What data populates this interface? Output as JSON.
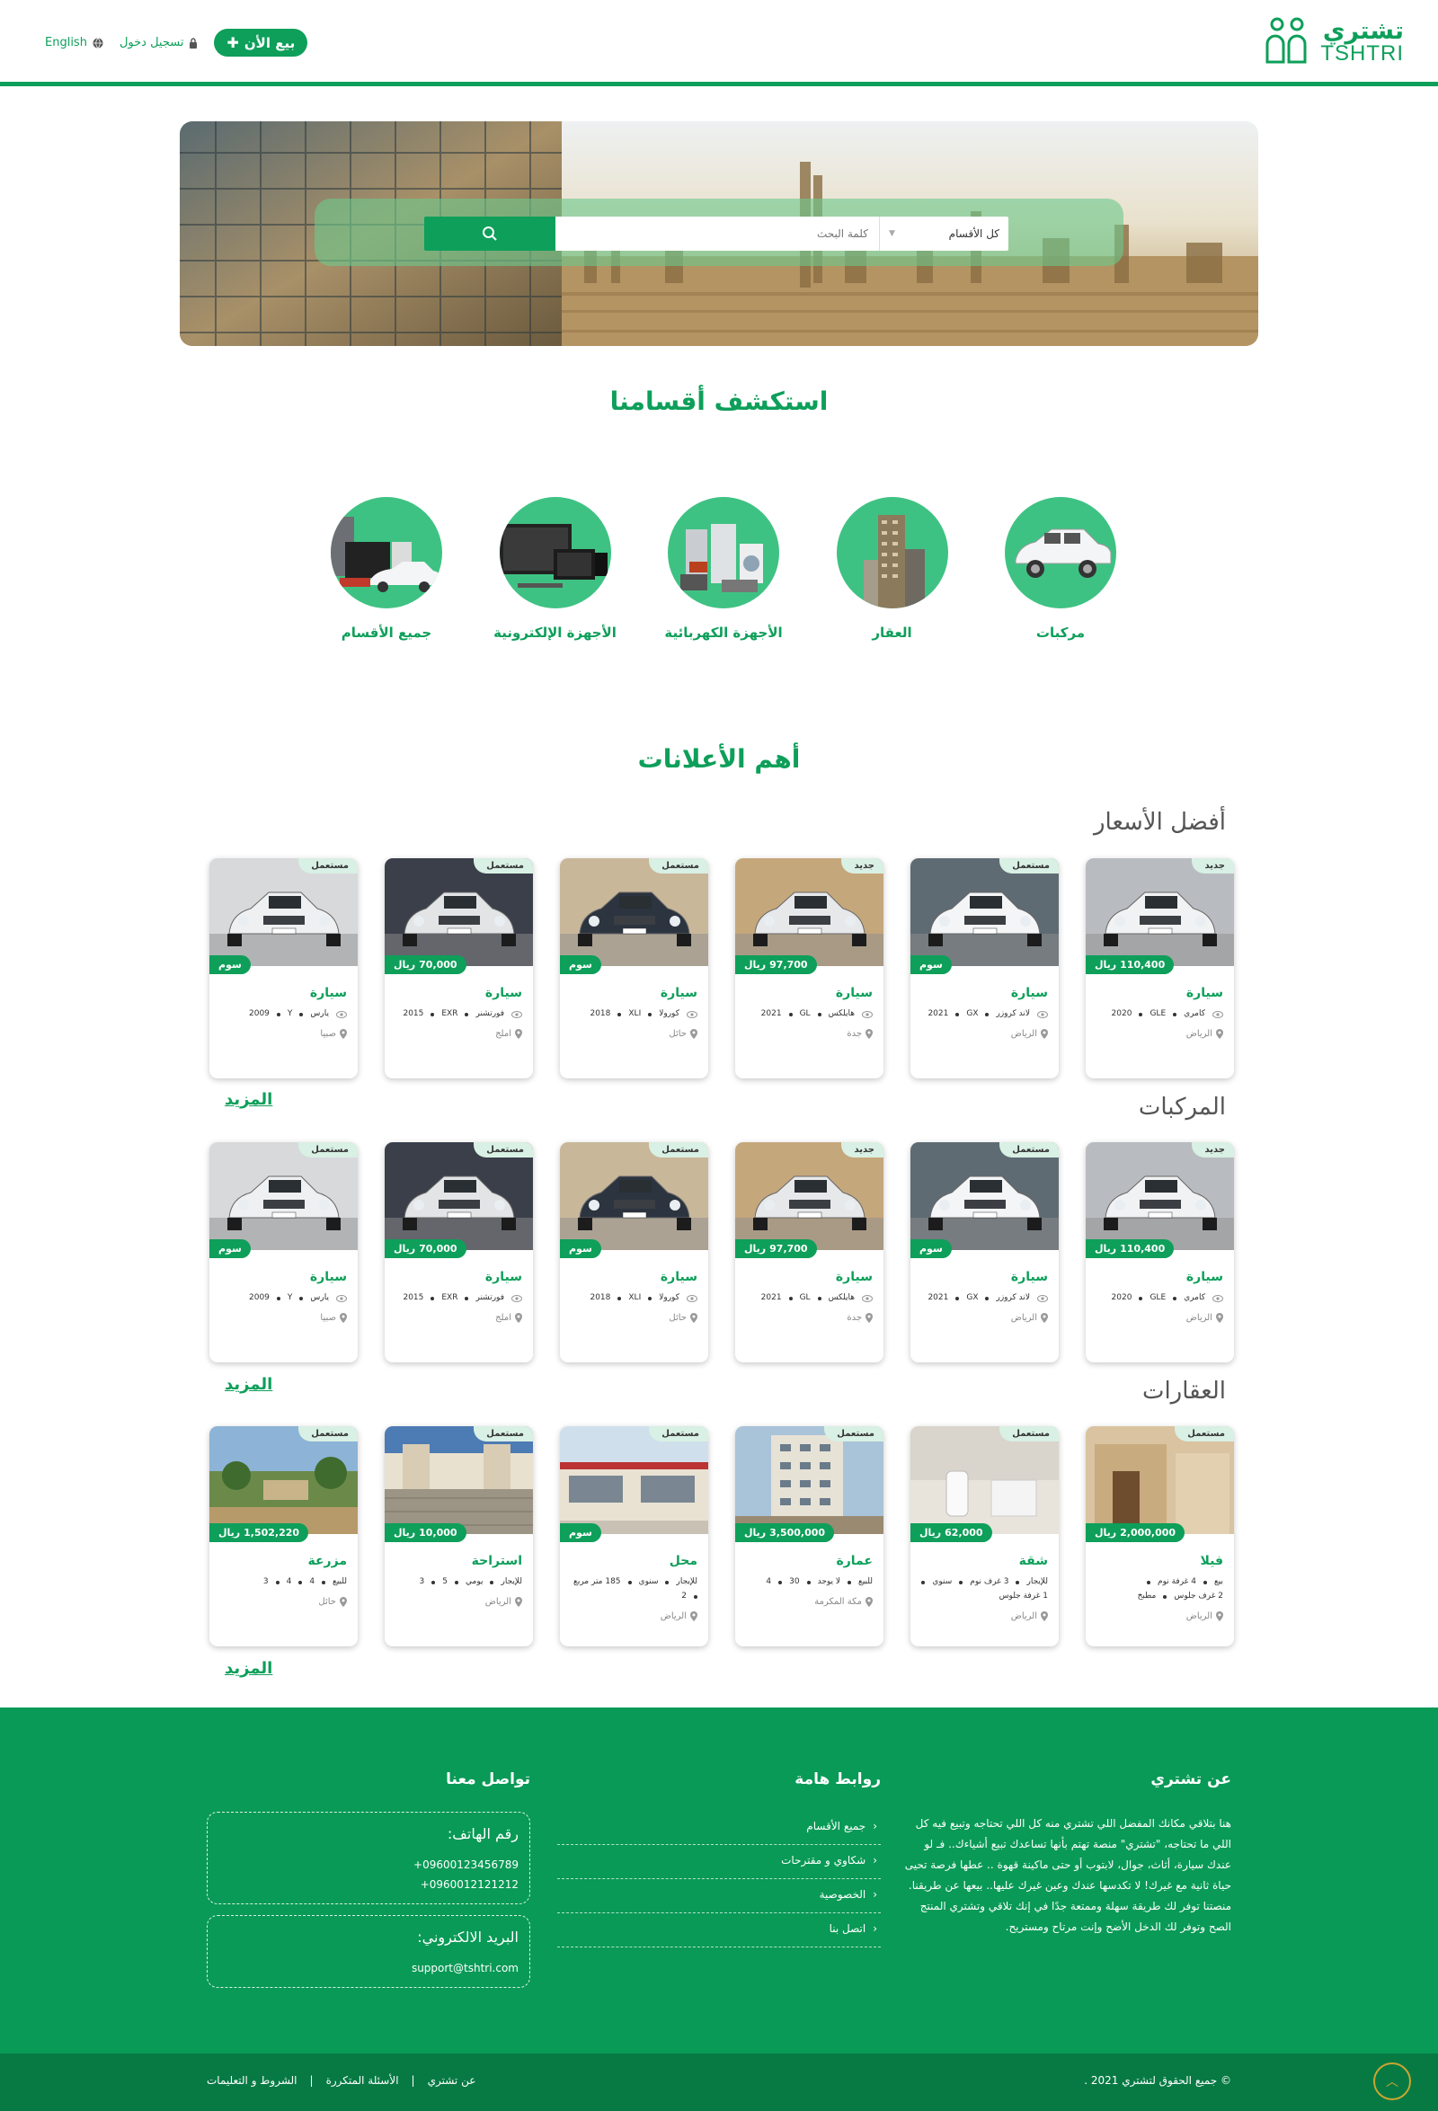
{
  "header": {
    "logo_ar": "تشتري",
    "logo_en": "TSHTRI",
    "sell_label": "بيع الأن",
    "login_label": "تسجيل دخول",
    "language_label": "English"
  },
  "search": {
    "category_selected": "كل الأقسام",
    "placeholder": "كلمة البحث"
  },
  "categories_section": {
    "title": "استكشف أقسامنا",
    "items": [
      {
        "label": "مركبات",
        "icon": "car-icon"
      },
      {
        "label": "العقار",
        "icon": "building-icon"
      },
      {
        "label": "الأجهزة الكهربائية",
        "icon": "appliances-icon"
      },
      {
        "label": "الأجهزة الإلكترونية",
        "icon": "electronics-icon"
      },
      {
        "label": "جميع الأقسام",
        "icon": "all-categories-icon"
      }
    ]
  },
  "ads_section": {
    "title": "أهم الأعلانات",
    "more_label": "المزيد",
    "rows": [
      {
        "title": "أفضل الأسعار",
        "cards": [
          {
            "badge": "جديد",
            "price": "110,400",
            "currency": "ريال",
            "title": "سيارة",
            "specs": [
              "كامري",
              "GLE",
              "2020"
            ],
            "location": "الرياض",
            "img": "white-camry"
          },
          {
            "badge": "مستعمل",
            "price": "سوم",
            "currency": "",
            "title": "سيارة",
            "specs": [
              "لاند كروزر",
              "GX",
              "2021"
            ],
            "location": "الرياض",
            "img": "landcruiser"
          },
          {
            "badge": "جديد",
            "price": "97,700",
            "currency": "ريال",
            "title": "سيارة",
            "specs": [
              "هايلكس",
              "GL",
              "2021"
            ],
            "location": "جدة",
            "img": "hilux"
          },
          {
            "badge": "مستعمل",
            "price": "سوم",
            "currency": "",
            "title": "سيارة",
            "specs": [
              "كورولا",
              "XLI",
              "2018"
            ],
            "location": "حائل",
            "img": "corolla"
          },
          {
            "badge": "مستعمل",
            "price": "70,000",
            "currency": "ريال",
            "title": "سيارة",
            "specs": [
              "فورتشنر",
              "EXR",
              "2015"
            ],
            "location": "املج",
            "img": "fortuner"
          },
          {
            "badge": "مستعمل",
            "price": "سوم",
            "currency": "",
            "title": "سيارة",
            "specs": [
              "يارس",
              "Y",
              "2009"
            ],
            "location": "صبيا",
            "img": "yaris"
          }
        ]
      },
      {
        "title": "المركبات",
        "cards": [
          {
            "badge": "جديد",
            "price": "110,400",
            "currency": "ريال",
            "title": "سيارة",
            "specs": [
              "كامري",
              "GLE",
              "2020"
            ],
            "location": "الرياض",
            "img": "white-camry"
          },
          {
            "badge": "مستعمل",
            "price": "سوم",
            "currency": "",
            "title": "سيارة",
            "specs": [
              "لاند كروزر",
              "GX",
              "2021"
            ],
            "location": "الرياض",
            "img": "landcruiser"
          },
          {
            "badge": "جديد",
            "price": "97,700",
            "currency": "ريال",
            "title": "سيارة",
            "specs": [
              "هايلكس",
              "GL",
              "2021"
            ],
            "location": "جدة",
            "img": "hilux"
          },
          {
            "badge": "مستعمل",
            "price": "سوم",
            "currency": "",
            "title": "سيارة",
            "specs": [
              "كورولا",
              "XLI",
              "2018"
            ],
            "location": "حائل",
            "img": "corolla"
          },
          {
            "badge": "مستعمل",
            "price": "70,000",
            "currency": "ريال",
            "title": "سيارة",
            "specs": [
              "فورتشنر",
              "EXR",
              "2015"
            ],
            "location": "املج",
            "img": "fortuner"
          },
          {
            "badge": "مستعمل",
            "price": "سوم",
            "currency": "",
            "title": "سيارة",
            "specs": [
              "يارس",
              "Y",
              "2009"
            ],
            "location": "صبيا",
            "img": "yaris"
          }
        ]
      },
      {
        "title": "العقارات",
        "cards": [
          {
            "badge": "مستعمل",
            "price": "2,000,000",
            "currency": "ريال",
            "title": "فيلا",
            "specs": [
              "بيع",
              "4 غرفة نوم",
              "2 غرف جلوس",
              "مطبخ"
            ],
            "location": "الرياض",
            "img": "villa"
          },
          {
            "badge": "مستعمل",
            "price": "62,000",
            "currency": "ريال",
            "title": "شقة",
            "specs": [
              "للإيجار",
              "3 غرف نوم",
              "سنوي",
              "1 غرفة جلوس"
            ],
            "location": "الرياض",
            "img": "apartment"
          },
          {
            "badge": "مستعمل",
            "price": "3,500,000",
            "currency": "ريال",
            "title": "عمارة",
            "specs": [
              "للبيع",
              "لا يوجد",
              "30",
              "4"
            ],
            "location": "مكة المكرمة",
            "img": "tower"
          },
          {
            "badge": "مستعمل",
            "price": "سوم",
            "currency": "",
            "title": "محل",
            "specs": [
              "للإيجار",
              "سنوي",
              "185 متر مربع",
              "2"
            ],
            "location": "الرياض",
            "img": "shop"
          },
          {
            "badge": "مستعمل",
            "price": "10,000",
            "currency": "ريال",
            "title": "استراحة",
            "specs": [
              "للإيجار",
              "يومي",
              "5",
              "3"
            ],
            "location": "الرياض",
            "img": "rest"
          },
          {
            "badge": "مستعمل",
            "price": "1,502,220",
            "currency": "ريال",
            "title": "مزرعة",
            "specs": [
              "للبيع",
              "4",
              "4",
              "3"
            ],
            "location": "حائل",
            "img": "farm"
          }
        ]
      }
    ]
  },
  "footer": {
    "about_title": "عن تشتري",
    "about_text": "هنا بتلاقي مكانك المفضل اللي تشتري منه كل اللي تحتاجه وتبيع فيه كل اللي ما تحتاجه، \"تشتري\" منصة تهتم بأنها تساعدك تبيع أشياءك.. فـ لو عندك سيارة، أثاث، جوال، لابتوب أو حتى ماكينة قهوة .. عطها فرصة تحيى حياة ثانية مع غيرك! لا تكدسها عندك وعين غيرك عليها.. بيعها عن طريقنا. منصتنا توفر لك طريقة سهلة وممتعة جدًا في إنك تلاقي وتشتري المنتج الصح وتوفر لك الدخل الأضح وإنت مرتاح ومستريح.",
    "links_title": "روابط هامة",
    "links": [
      "جميع الأقسام",
      "شكاوي و مقترحات",
      "الخصوصية",
      "اتصل بنا"
    ],
    "contact_title": "تواصل معنا",
    "phone_label": "رقم الهاتف:",
    "phones": [
      "+09600123456789",
      "+0960012121212"
    ],
    "email_label": "البريد الالكتروني:",
    "email": "support@tshtri.com",
    "copyright": "© جميع الحقوق لتشتري 2021 .",
    "bottom_links": [
      "عن تشتري",
      "الأسئلة المتكررة",
      "الشروط و التعليمات"
    ],
    "separator": "|"
  },
  "colors": {
    "brand": "#0e9f5a",
    "footer": "#089a56",
    "footer_bottom": "#077a44",
    "badge_bg": "#d9f0e4"
  }
}
